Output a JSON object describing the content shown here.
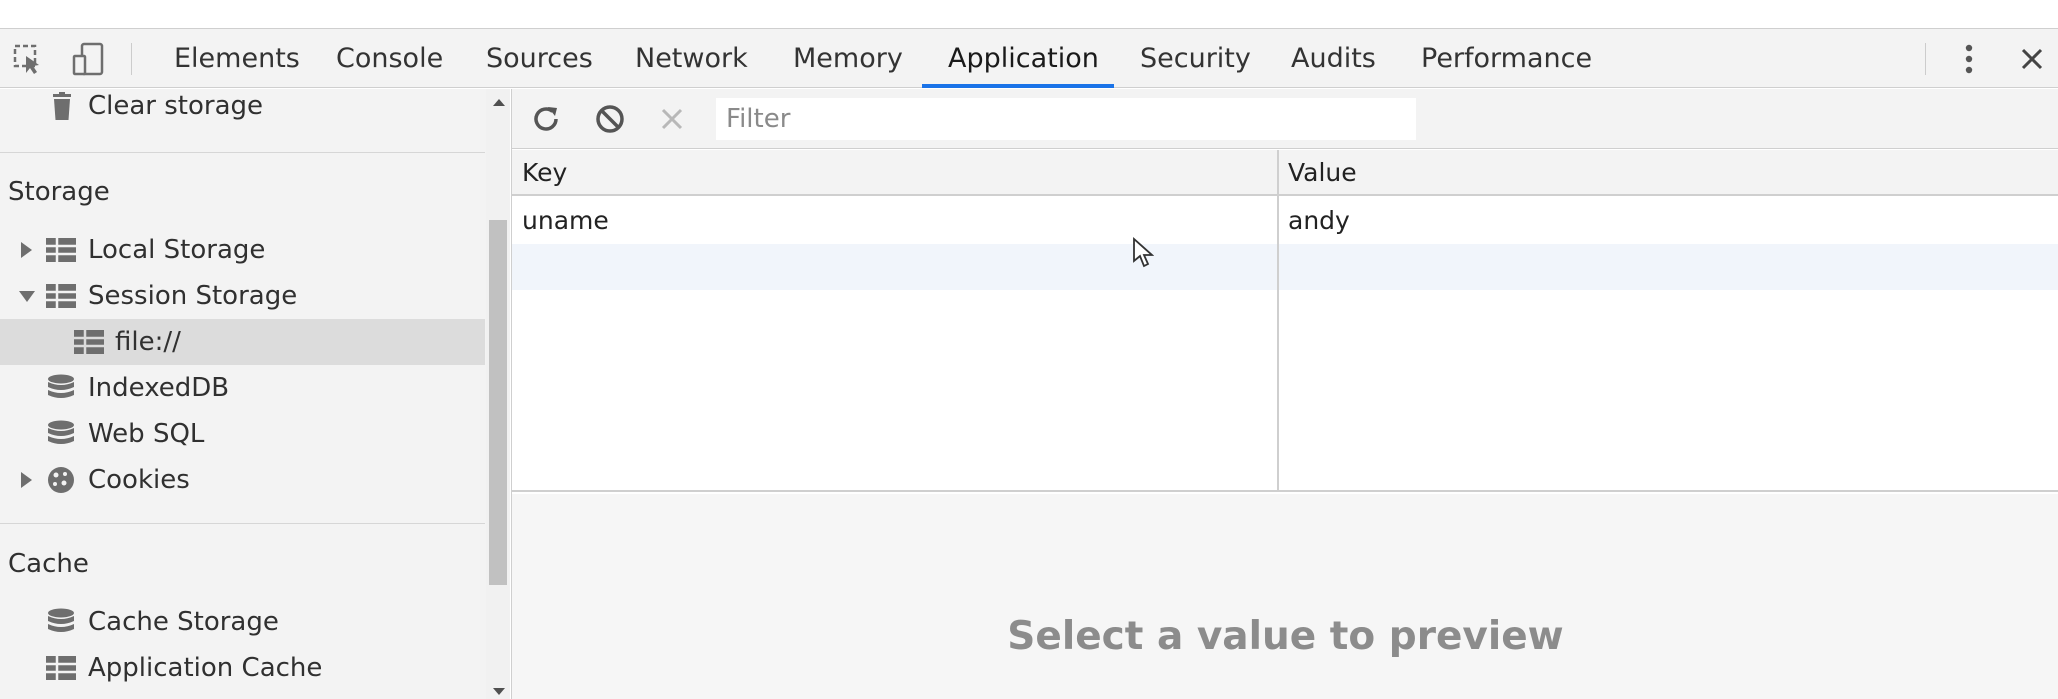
{
  "devtools": {
    "tabs": [
      "Elements",
      "Console",
      "Sources",
      "Network",
      "Memory",
      "Application",
      "Security",
      "Audits",
      "Performance"
    ],
    "active_tab": "Application",
    "icons": {
      "inspect": "inspect-element-icon",
      "device": "device-toolbar-icon",
      "more": "more-options-icon",
      "close": "close-icon"
    },
    "accent_color": "#1a73e8"
  },
  "sidebar": {
    "clear_storage": "Clear storage",
    "storage_section": "Storage",
    "local_storage": "Local Storage",
    "session_storage": "Session Storage",
    "session_origin": "file://",
    "indexeddb": "IndexedDB",
    "web_sql": "Web SQL",
    "cookies": "Cookies",
    "cache_section": "Cache",
    "cache_storage": "Cache Storage",
    "application_cache": "Application Cache"
  },
  "toolbar": {
    "filter_placeholder": "Filter",
    "icons": [
      "refresh-icon",
      "clear-all-icon",
      "delete-selected-icon"
    ]
  },
  "table": {
    "columns": [
      "Key",
      "Value"
    ],
    "rows": [
      {
        "key": "uname",
        "value": "andy"
      }
    ]
  },
  "preview": {
    "empty_text": "Select a value to preview"
  }
}
